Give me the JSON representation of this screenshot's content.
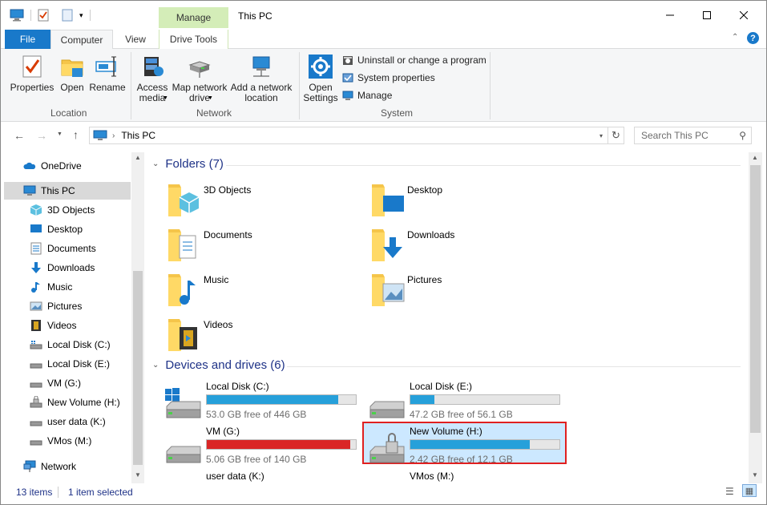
{
  "window": {
    "title": "This PC",
    "context_tab": "Manage"
  },
  "tabs": {
    "file": "File",
    "computer": "Computer",
    "view": "View",
    "drive_tools": "Drive Tools"
  },
  "ribbon": {
    "location": {
      "label": "Location",
      "properties": "Properties",
      "open": "Open",
      "rename": "Rename"
    },
    "network": {
      "label": "Network",
      "access_media_1": "Access",
      "access_media_2": "media",
      "map_drive_1": "Map network",
      "map_drive_2": "drive",
      "add_location_1": "Add a network",
      "add_location_2": "location"
    },
    "system": {
      "label": "System",
      "open_settings_1": "Open",
      "open_settings_2": "Settings",
      "uninstall": "Uninstall or change a program",
      "system_properties": "System properties",
      "manage": "Manage"
    }
  },
  "address": {
    "path": "This PC",
    "search_placeholder": "Search This PC"
  },
  "nav": {
    "items": [
      {
        "label": "OneDrive",
        "icon": "cloud-icon"
      },
      {
        "label": "This PC",
        "icon": "computer-icon"
      },
      {
        "label": "3D Objects",
        "icon": "cube-icon"
      },
      {
        "label": "Desktop",
        "icon": "desktop-icon"
      },
      {
        "label": "Documents",
        "icon": "document-icon"
      },
      {
        "label": "Downloads",
        "icon": "download-arrow-icon"
      },
      {
        "label": "Music",
        "icon": "music-note-icon"
      },
      {
        "label": "Pictures",
        "icon": "picture-icon"
      },
      {
        "label": "Videos",
        "icon": "film-icon"
      },
      {
        "label": "Local Disk (C:)",
        "icon": "drive-icon"
      },
      {
        "label": "Local Disk (E:)",
        "icon": "drive-icon"
      },
      {
        "label": "VM (G:)",
        "icon": "drive-icon"
      },
      {
        "label": "New Volume (H:)",
        "icon": "locked-drive-icon"
      },
      {
        "label": "user data (K:)",
        "icon": "drive-icon"
      },
      {
        "label": "VMos (M:)",
        "icon": "drive-icon"
      },
      {
        "label": "Network",
        "icon": "network-icon"
      }
    ]
  },
  "folders": {
    "header": "Folders (7)",
    "items": [
      {
        "label": "3D Objects"
      },
      {
        "label": "Desktop"
      },
      {
        "label": "Documents"
      },
      {
        "label": "Downloads"
      },
      {
        "label": "Music"
      },
      {
        "label": "Pictures"
      },
      {
        "label": "Videos"
      }
    ]
  },
  "drives": {
    "header": "Devices and drives (6)",
    "items": [
      {
        "name": "Local Disk (C:)",
        "free": "53.0 GB free of 446 GB",
        "used_fraction": 0.88,
        "color": "#26a0da"
      },
      {
        "name": "Local Disk (E:)",
        "free": "47.2 GB free of 56.1 GB",
        "used_fraction": 0.16,
        "color": "#26a0da"
      },
      {
        "name": "VM (G:)",
        "free": "5.06 GB free of 140 GB",
        "used_fraction": 0.96,
        "color": "#da2626"
      },
      {
        "name": "New Volume (H:)",
        "free": "2.42 GB free of 12.1 GB",
        "used_fraction": 0.8,
        "color": "#26a0da"
      },
      {
        "name": "user data (K:)",
        "free": ""
      },
      {
        "name": "VMos (M:)",
        "free": ""
      }
    ],
    "highlight_color": "#e02020"
  },
  "status": {
    "item_count": "13 items",
    "selected": "1 item selected"
  }
}
